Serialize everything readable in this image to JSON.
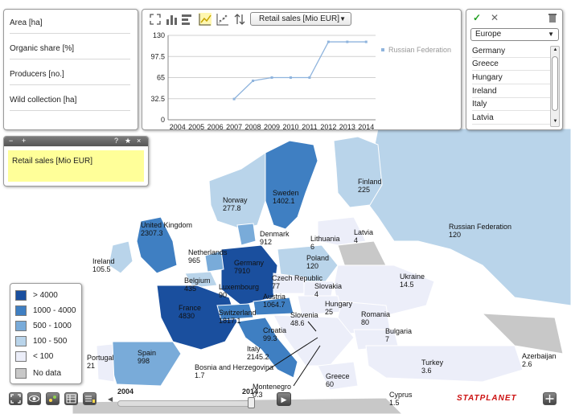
{
  "indicators": [
    {
      "label": "Area [ha]"
    },
    {
      "label": "Organic share [%]"
    },
    {
      "label": "Producers [no.]"
    },
    {
      "label": "Wild collection [ha]"
    }
  ],
  "chart_panel": {
    "indicator_select": "Retail sales [Mio EUR]",
    "toolbar_icons": [
      "zoom-icon",
      "bar-chart-icon",
      "horizontal-bar-icon",
      "line-chart-icon",
      "scatter-icon",
      "sort-icon"
    ]
  },
  "chart_data": {
    "type": "line",
    "x": [
      2004,
      2005,
      2006,
      2007,
      2008,
      2009,
      2010,
      2011,
      2012,
      2013,
      2014
    ],
    "series": [
      {
        "name": "Russian Federation",
        "values": [
          null,
          null,
          null,
          32,
          60,
          65,
          65,
          65,
          120,
          120,
          120
        ]
      }
    ],
    "yticks": [
      0,
      32.5,
      65,
      97.5,
      130
    ],
    "ylim": [
      0,
      130
    ],
    "grid": true,
    "legend": "right",
    "color": "#8fb4dd"
  },
  "region_panel": {
    "selected_region": "Europe",
    "countries": [
      "Germany",
      "Greece",
      "Hungary",
      "Ireland",
      "Italy",
      "Latvia"
    ]
  },
  "selected_indicator": {
    "label": "Retail sales [Mio EUR]",
    "bar_buttons": [
      "−",
      "+",
      "?",
      "★",
      "×"
    ]
  },
  "legend": {
    "items": [
      {
        "label": "> 4000",
        "color": "#1a4f9e"
      },
      {
        "label": "1000 - 4000",
        "color": "#3f7fc2"
      },
      {
        "label": "500 - 1000",
        "color": "#79abd9"
      },
      {
        "label": "100 - 500",
        "color": "#b9d4ea"
      },
      {
        "label": "< 100",
        "color": "#eceef9"
      },
      {
        "label": "No data",
        "color": "#c8c8c8"
      }
    ]
  },
  "map_labels": [
    {
      "text": "Finland\n225"
    },
    {
      "text": "Sweden\n1402.1"
    },
    {
      "text": "Norway\n277.8"
    },
    {
      "text": "United Kingdom\n2307.3"
    },
    {
      "text": "Ireland\n105.5"
    },
    {
      "text": "Denmark\n912"
    },
    {
      "text": "Netherlands\n965"
    },
    {
      "text": "Belgium\n435"
    },
    {
      "text": "Luxembourg\n90"
    },
    {
      "text": "Germany\n7910"
    },
    {
      "text": "France\n4830"
    },
    {
      "text": "Switzerland\n1817.1"
    },
    {
      "text": "Austria\n1064.7"
    },
    {
      "text": "Czech Republic\n77"
    },
    {
      "text": "Slovakia\n4"
    },
    {
      "text": "Poland\n120"
    },
    {
      "text": "Lithuania\n6"
    },
    {
      "text": "Latvia\n4"
    },
    {
      "text": "Russian Federation\n120"
    },
    {
      "text": "Ukraine\n14.5"
    },
    {
      "text": "Hungary\n25"
    },
    {
      "text": "Slovenia\n48.6"
    },
    {
      "text": "Croatia\n99.3"
    },
    {
      "text": "Romania\n80"
    },
    {
      "text": "Bulgaria\n7"
    },
    {
      "text": "Italy\n2145.2"
    },
    {
      "text": "Spain\n998"
    },
    {
      "text": "Portugal\n21"
    },
    {
      "text": "Bosnia and Herzegovina\n1.7"
    },
    {
      "text": "Montenegro\n0.3"
    },
    {
      "text": "Greece\n60"
    },
    {
      "text": "Turkey\n3.6"
    },
    {
      "text": "Azerbaijan\n2.6"
    },
    {
      "text": "Cyprus\n1.5"
    }
  ],
  "timeline": {
    "start_label": "2004",
    "end_label": "2014"
  },
  "brand": "STATPLANET"
}
